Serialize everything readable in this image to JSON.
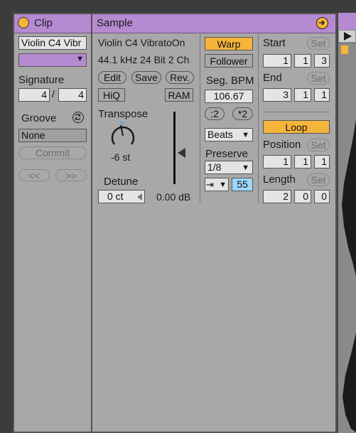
{
  "clip": {
    "title": "Clip",
    "clip_name": "Violin C4 Vibr",
    "color_dropdown_arrow": "▼",
    "signature_label": "Signature",
    "signature_numerator": "4",
    "signature_slash": "/",
    "signature_denominator": "4",
    "groove_label": "Groove",
    "groove_value": "None",
    "commit_label": "Commit",
    "nudge_back_label": "<<",
    "nudge_forward_label": ">>"
  },
  "sample": {
    "title": "Sample",
    "file_name": "Violin C4 VibratoOn",
    "file_info": "44.1 kHz 24 Bit 2 Ch",
    "edit_label": "Edit",
    "save_label": "Save",
    "rev_label": "Rev.",
    "hiq_label": "HiQ",
    "ram_label": "RAM",
    "transpose_label": "Transpose",
    "transpose_value": "-6 st",
    "detune_label": "Detune",
    "detune_value": "0 ct",
    "gain_value": "0.00 dB",
    "warp_label": "Warp",
    "follower_label": "Follower",
    "seg_bpm_label": "Seg. BPM",
    "seg_bpm_value": "106.67",
    "half_label": ":2",
    "double_label": "*2",
    "warp_mode": "Beats",
    "preserve_label": "Preserve",
    "preserve_value": "1/8",
    "transient_loop_value": "55",
    "start_label": "Start",
    "start_set_label": "Set",
    "start_values": [
      "1",
      "1",
      "3"
    ],
    "end_label": "End",
    "end_set_label": "Set",
    "end_values": [
      "3",
      "1",
      "1"
    ],
    "loop_label": "Loop",
    "position_label": "Position",
    "position_set_label": "Set",
    "position_values": [
      "1",
      "1",
      "1"
    ],
    "length_label": "Length",
    "length_set_label": "Set",
    "length_values": [
      "2",
      "0",
      "0"
    ]
  },
  "colors": {
    "header_purple": "#b58ad1",
    "warp_orange": "#f5b43a",
    "panel_gray": "#a8a8a8",
    "field_light": "#e4e4e4",
    "blue_value": "#9ed8ff"
  },
  "icons": {
    "clip_activator": "circle-orange-icon",
    "sample_toggle": "arrow-right-circle-icon",
    "groove_hotswap": "hot-swap-icon",
    "gain_triangle": "triangle-left-icon"
  }
}
